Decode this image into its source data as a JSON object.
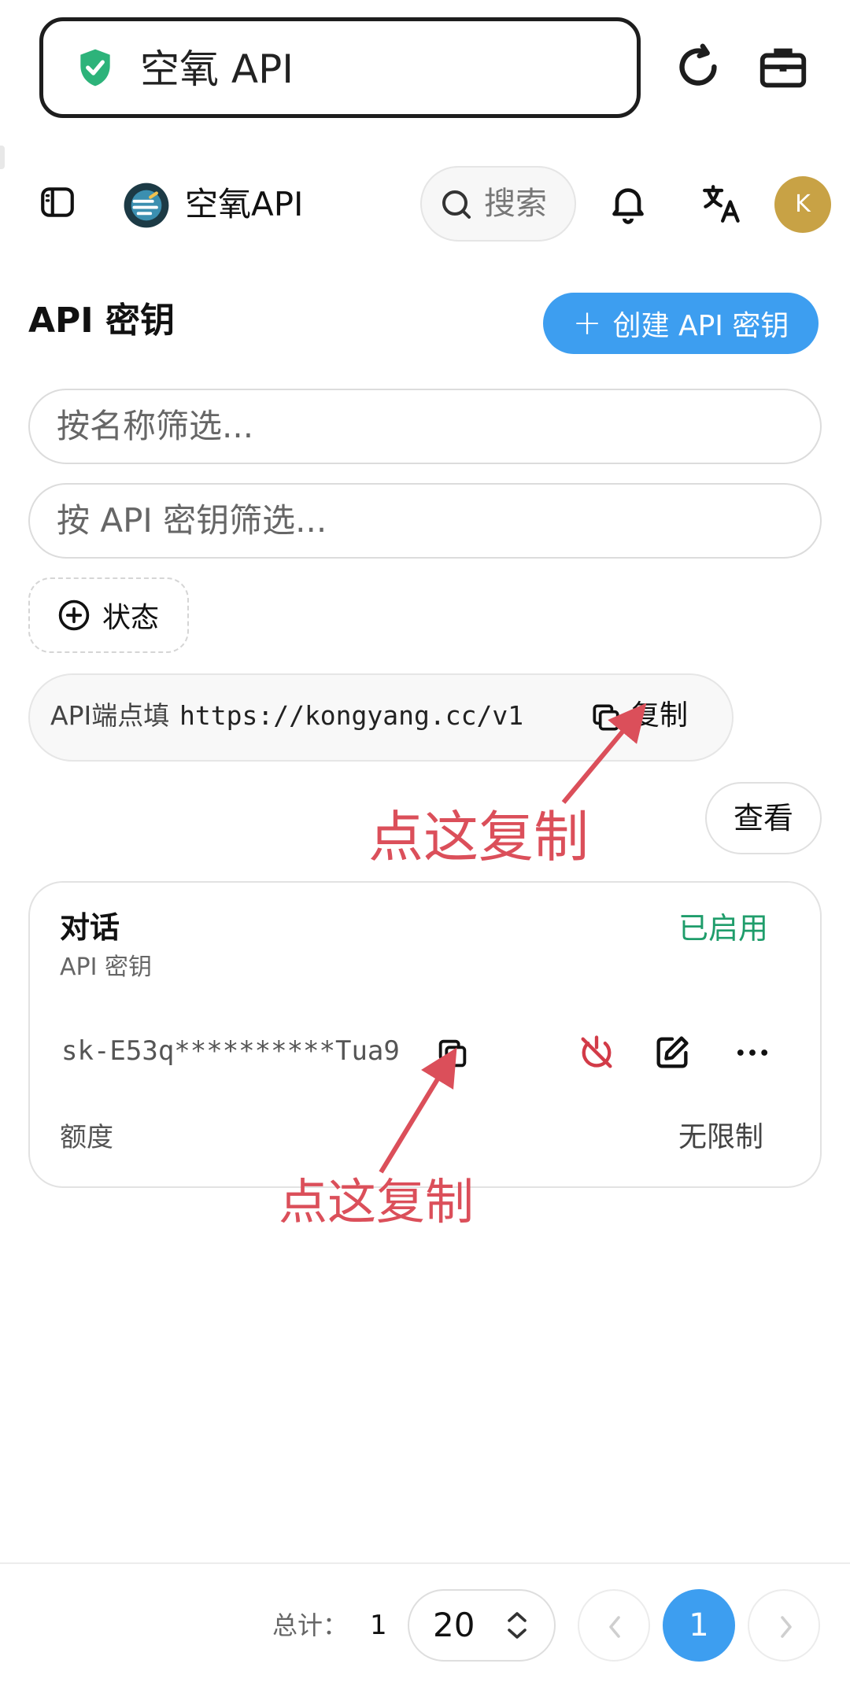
{
  "browser": {
    "url_title": "空氧 API",
    "colors": {
      "shield": "#2db37a"
    }
  },
  "header": {
    "site_name": "空氧API",
    "search_label": "搜索",
    "avatar_initial": "K",
    "colors": {
      "avatar": "#c8a245"
    }
  },
  "page": {
    "title": "API 密钥",
    "create_button": "创建 API 密钥",
    "create_plus": "+"
  },
  "filters": {
    "name_placeholder": "按名称筛选...",
    "key_placeholder": "按 API 密钥筛选...",
    "status_label": "状态"
  },
  "endpoint": {
    "label": "API端点填",
    "url": "https://kongyang.cc/v1",
    "copy_label": "复制"
  },
  "view_button": "查看",
  "annotations": {
    "copy_endpoint_hint": "点这复制",
    "copy_key_hint": "点这复制"
  },
  "key_card": {
    "name": "对话",
    "subtitle": "API 密钥",
    "status": "已启用",
    "key_masked": "sk-E53q**********Tua9",
    "quota_label": "额度",
    "quota_value": "无限制",
    "colors": {
      "status": "#1f9d6b",
      "disable_icon": "#d23b48"
    }
  },
  "pagination": {
    "total_label": "总计：",
    "total_value": "1",
    "page_size": "20",
    "current_page": "1"
  },
  "theme": {
    "accent": "#3d9ef0",
    "annotation": "#db4f5a"
  }
}
